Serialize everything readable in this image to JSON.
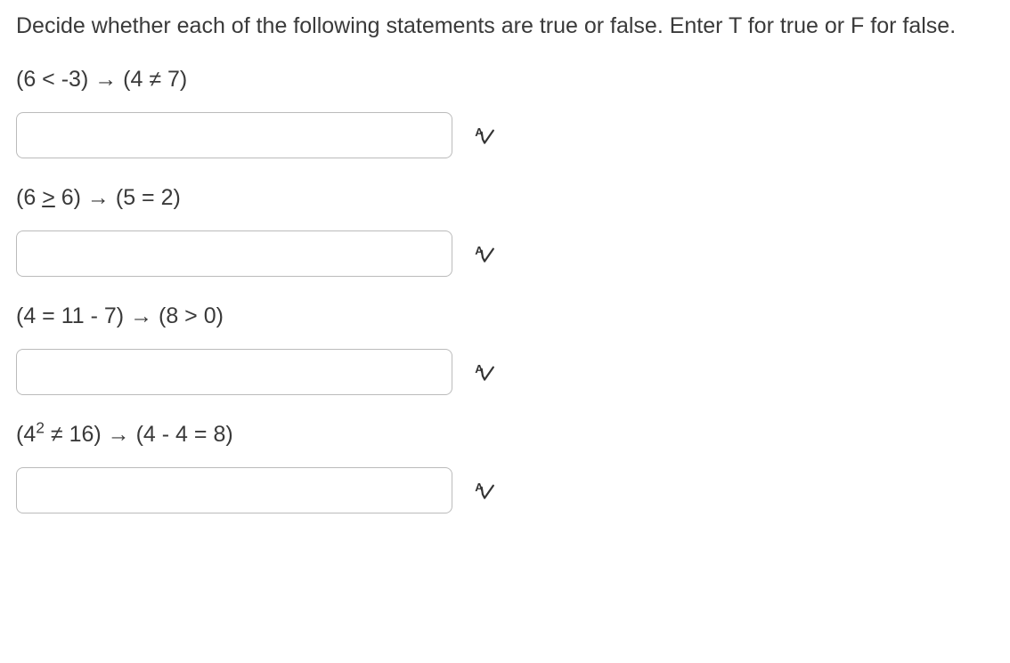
{
  "instructions": "Decide whether each of the following statements are true or false. Enter T for true or F for false.",
  "questions": [
    {
      "statement": "(6 < -3) → (4 ≠ 7)",
      "value": ""
    },
    {
      "statement": "(6 ≥ 6) → (5 = 2)",
      "value": ""
    },
    {
      "statement": "(4 = 11 - 7) → (8 > 0)",
      "value": ""
    },
    {
      "statement": "(4² ≠ 16) → (4 - 4 = 8)",
      "value": ""
    }
  ]
}
